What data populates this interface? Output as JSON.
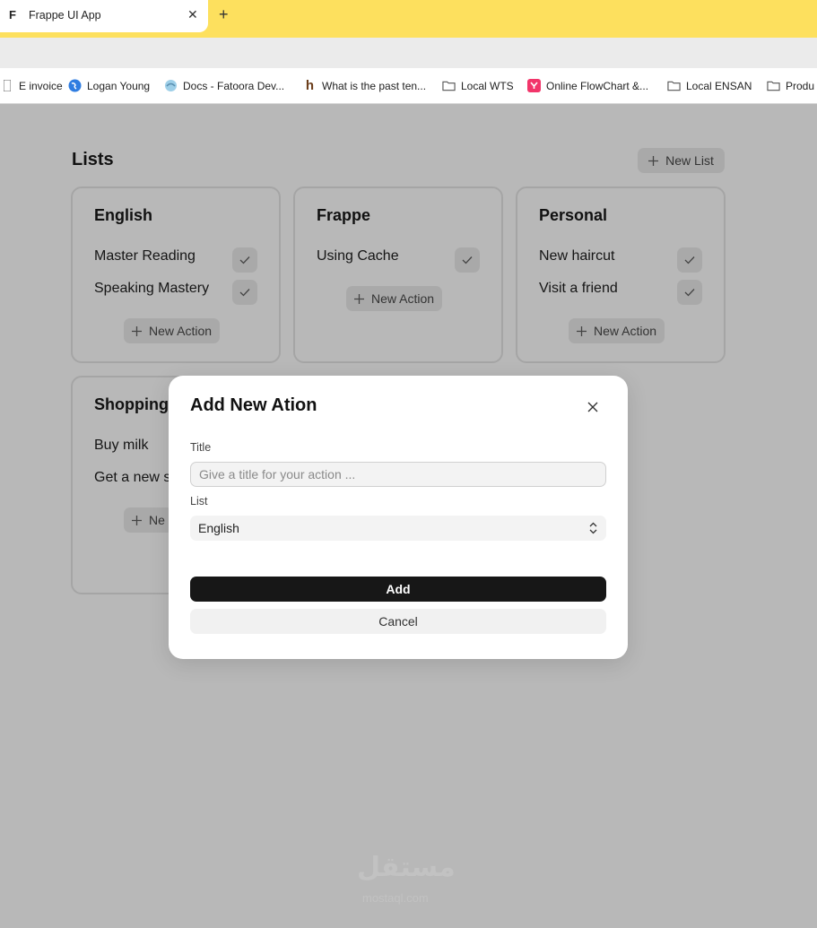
{
  "browser": {
    "tab_title": "Frappe UI App",
    "tab_favicon": "F",
    "tab_close": "✕",
    "new_tab": "+",
    "bookmarks": [
      {
        "label": "E invoice",
        "icon": "page-icon"
      },
      {
        "label": "Logan Young",
        "icon": "globe-icon"
      },
      {
        "label": "Docs - Fatoora Dev...",
        "icon": "docs-icon"
      },
      {
        "label": "What is the past ten...",
        "icon": "h-icon"
      },
      {
        "label": "Local WTS",
        "icon": "folder-icon"
      },
      {
        "label": "Online FlowChart &...",
        "icon": "flowchart-icon"
      },
      {
        "label": "Local ENSAN",
        "icon": "folder-icon"
      },
      {
        "label": "Produ",
        "icon": "folder-icon"
      }
    ]
  },
  "page": {
    "title": "Lists",
    "new_list_label": "New List"
  },
  "lists": [
    {
      "title": "English",
      "items": [
        "Master Reading",
        "Speaking Mastery"
      ],
      "action_label": "New Action"
    },
    {
      "title": "Frappe",
      "items": [
        "Using Cache"
      ],
      "action_label": "New Action"
    },
    {
      "title": "Personal",
      "items": [
        "New haircut",
        "Visit a friend"
      ],
      "action_label": "New Action"
    },
    {
      "title": "Shopping",
      "items": [
        "Buy milk",
        "Get a new s"
      ],
      "action_label": "Ne"
    }
  ],
  "modal": {
    "title": "Add New Ation",
    "title_label": "Title",
    "title_placeholder": "Give a title for your action ...",
    "title_value": "",
    "list_label": "List",
    "list_selected": "English",
    "add_label": "Add",
    "cancel_label": "Cancel"
  },
  "watermark": {
    "text": "مستقل",
    "sub": "mostaql.com"
  },
  "colors": {
    "tabbar": "#fde05e",
    "overlay_page": "#b8b8b8",
    "primary_button": "#171717"
  }
}
